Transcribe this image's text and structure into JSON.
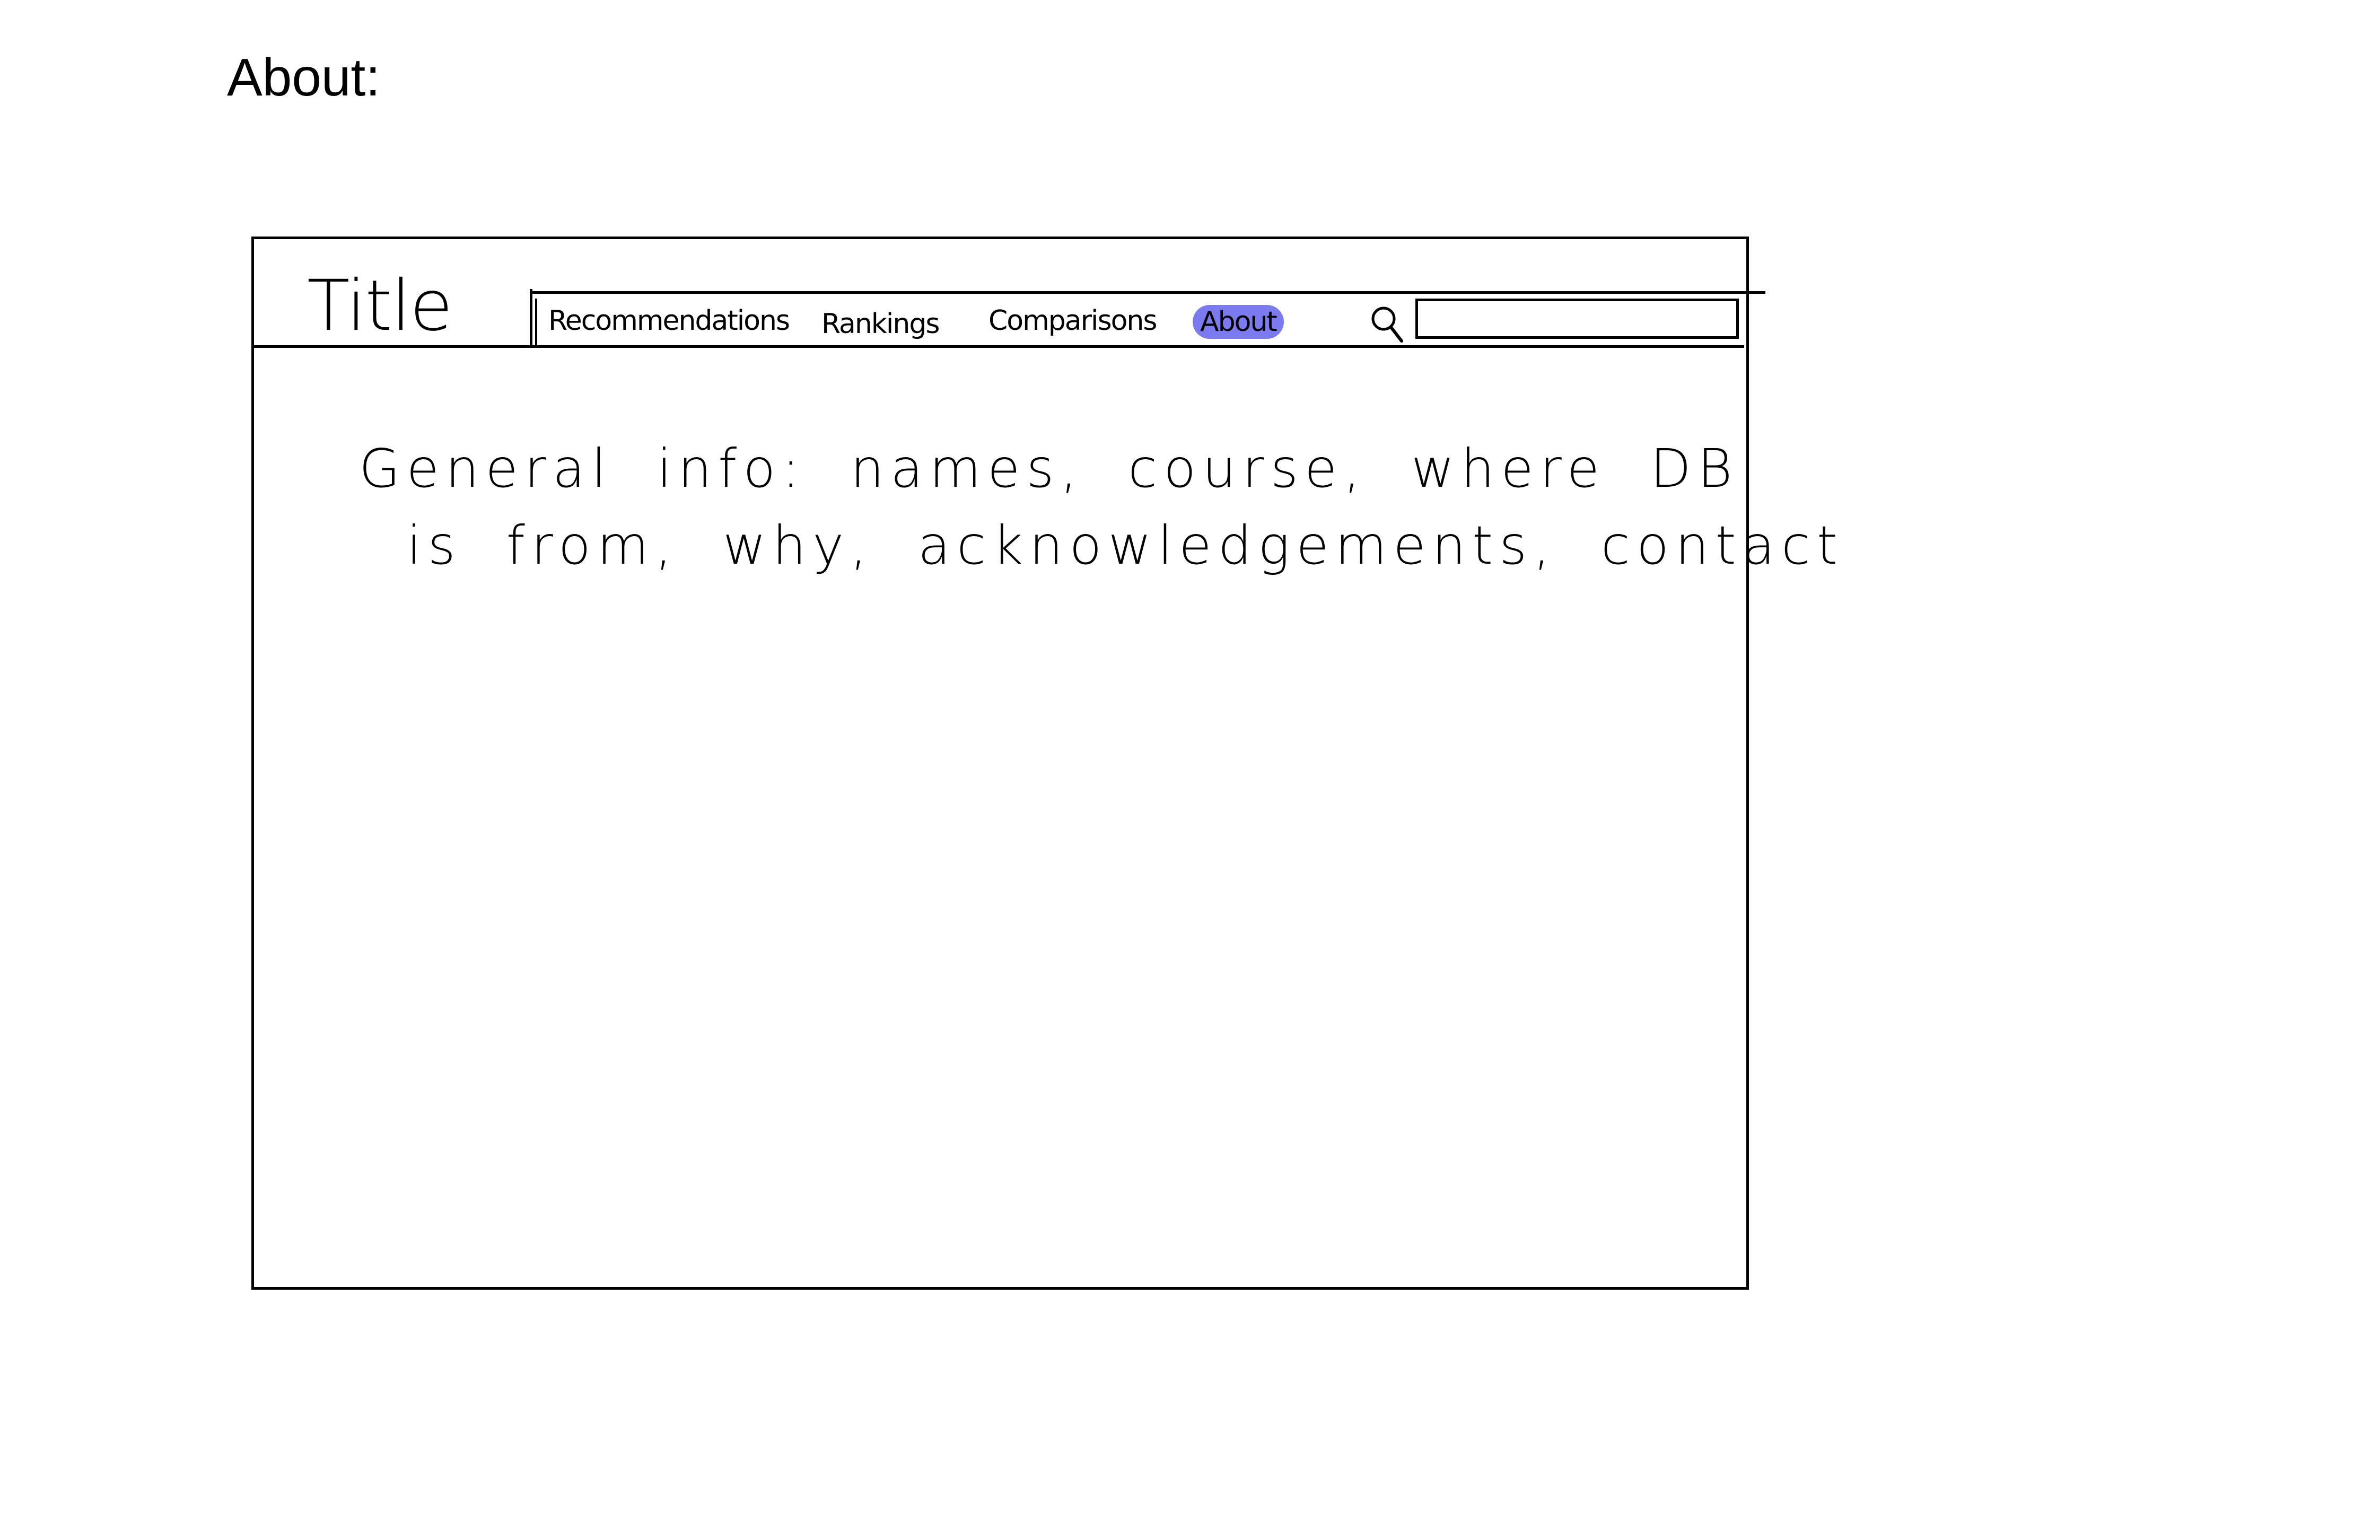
{
  "page": {
    "heading": "About:"
  },
  "header": {
    "title": "Title"
  },
  "nav": {
    "items": [
      {
        "label": "Recommendations"
      },
      {
        "label": "Rankings"
      },
      {
        "label": "Comparisons"
      },
      {
        "label": "About",
        "active": true
      }
    ],
    "active_highlight_color": "#7b7bef"
  },
  "search": {
    "icon": "search-icon",
    "value": "",
    "placeholder": ""
  },
  "content": {
    "line1": "General info: names, course, where DB",
    "line2": "is from, why, acknowledgements, contact"
  }
}
